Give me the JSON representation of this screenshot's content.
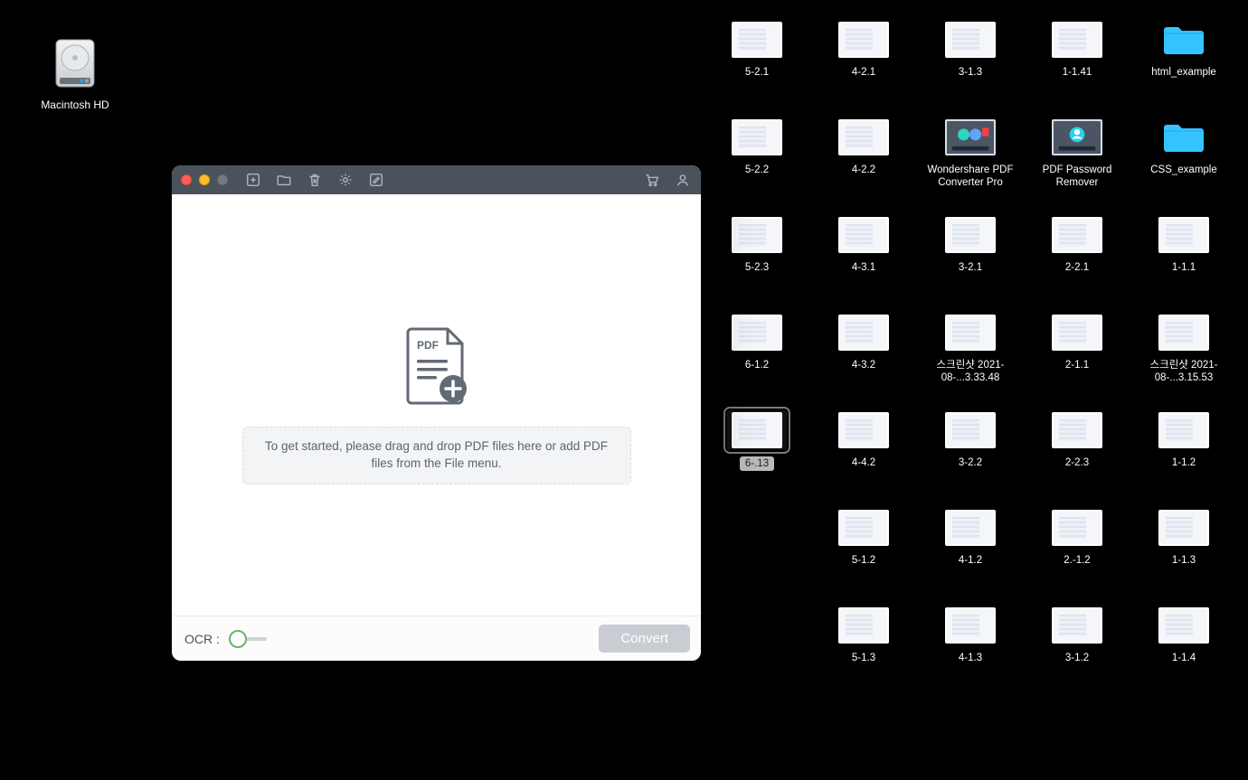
{
  "desktop": {
    "drive_label": "Macintosh HD",
    "items": [
      {
        "label": "5-2.1",
        "type": "img"
      },
      {
        "label": "4-2.1",
        "type": "img"
      },
      {
        "label": "3-1.3",
        "type": "img"
      },
      {
        "label": "1-1.41",
        "type": "img"
      },
      {
        "label": "html_example",
        "type": "folder"
      },
      {
        "label": "5-2.2",
        "type": "img"
      },
      {
        "label": "4-2.2",
        "type": "img"
      },
      {
        "label": "Wondershare PDF Converter Pro",
        "type": "app"
      },
      {
        "label": "PDF Password Remover",
        "type": "app"
      },
      {
        "label": "CSS_example",
        "type": "folder"
      },
      {
        "label": "5-2.3",
        "type": "img"
      },
      {
        "label": "4-3.1",
        "type": "img"
      },
      {
        "label": "3-2.1",
        "type": "img"
      },
      {
        "label": "2-2.1",
        "type": "img"
      },
      {
        "label": "1-1.1",
        "type": "img"
      },
      {
        "label": "6-1.2",
        "type": "img"
      },
      {
        "label": "4-3.2",
        "type": "img"
      },
      {
        "label": "스크린샷 2021-08-...3.33.48",
        "type": "img"
      },
      {
        "label": "2-1.1",
        "type": "img"
      },
      {
        "label": "스크린샷 2021-08-...3.15.53",
        "type": "img"
      },
      {
        "label": "6-.13",
        "type": "img",
        "selected": true
      },
      {
        "label": "4-4.2",
        "type": "img"
      },
      {
        "label": "3-2.2",
        "type": "img"
      },
      {
        "label": "2-2.3",
        "type": "img"
      },
      {
        "label": "1-1.2",
        "type": "img"
      },
      {
        "label": "",
        "type": "empty"
      },
      {
        "label": "5-1.2",
        "type": "img"
      },
      {
        "label": "4-1.2",
        "type": "img"
      },
      {
        "label": "2.-1.2",
        "type": "img"
      },
      {
        "label": "1-1.3",
        "type": "img"
      },
      {
        "label": "",
        "type": "empty"
      },
      {
        "label": "5-1.3",
        "type": "img"
      },
      {
        "label": "4-1.3",
        "type": "img"
      },
      {
        "label": "3-1.2",
        "type": "img"
      },
      {
        "label": "1-1.4",
        "type": "img"
      }
    ]
  },
  "app_window": {
    "pdf_badge": "PDF",
    "drop_hint": "To get started, please drag and drop PDF files here or add PDF files from the File menu.",
    "ocr_label": "OCR :",
    "convert_label": "Convert"
  }
}
